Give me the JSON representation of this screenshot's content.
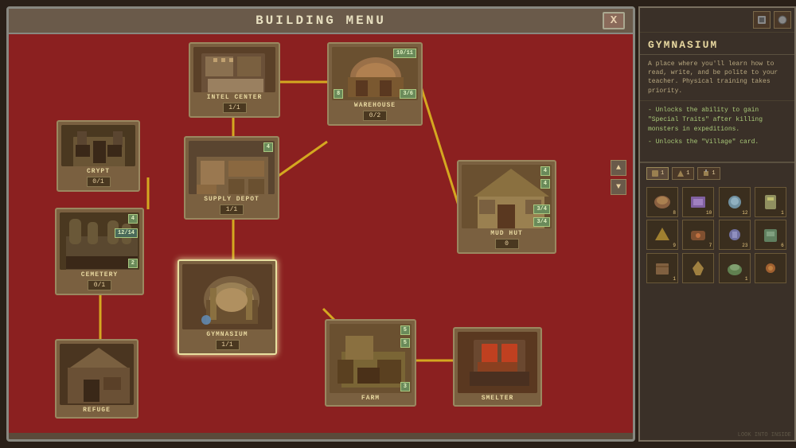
{
  "menu": {
    "title": "BUILDING MENU",
    "close_label": "X"
  },
  "buildings": [
    {
      "id": "intel-center",
      "label": "INTEL CENTER",
      "counter": "1/1",
      "badge_top": null,
      "badge_bottom": null,
      "color": "#6a5030"
    },
    {
      "id": "warehouse",
      "label": "WAREHOUSE",
      "counter": "0/2",
      "badge_top": "10/11",
      "badge_bottom": "8",
      "badge_br": "3/6",
      "color": "#7a6040"
    },
    {
      "id": "crypt",
      "label": "CRYPT",
      "counter": "0/1",
      "color": "#5a4830"
    },
    {
      "id": "supply-depot",
      "label": "SUPPLY DEPOT",
      "counter": "1/1",
      "badge_top": "4",
      "color": "#6a5535"
    },
    {
      "id": "cemetery",
      "label": "CEMETERY",
      "counter": "0/1",
      "badge_top": "4",
      "badge_mid": "12/14",
      "badge_bottom": "2",
      "color": "#5a4528"
    },
    {
      "id": "mud-hut",
      "label": "MUD HUT",
      "counter": "0",
      "badge_top": "4",
      "badge_mid": "4",
      "badge_br": "3/4",
      "badge_br2": "3/4",
      "color": "#7a6040"
    },
    {
      "id": "gymnasium",
      "label": "GYMNASIUM",
      "counter": "1/1",
      "selected": true,
      "color": "#6a5030"
    },
    {
      "id": "farm",
      "label": "FARM",
      "badge_top": "5",
      "badge_mid": "5",
      "badge_bottom": "3",
      "color": "#7a6040"
    },
    {
      "id": "smelter",
      "label": "SMELTER",
      "color": "#6a5030"
    },
    {
      "id": "refuge",
      "label": "REFUGE",
      "color": "#5a4525"
    }
  ],
  "right_panel": {
    "title": "GYMNASIUM",
    "description": "A place where you'll learn how to read, write, and be polite to your teacher. Physical training takes priority.",
    "bullets": [
      "- Unlocks the ability to gain \"Special Traits\" after killing monsters in expeditions.",
      "- Unlocks the \"Village\" card."
    ]
  },
  "resource_tabs": [
    {
      "icon": "🏛",
      "count": "1"
    },
    {
      "icon": "⚒",
      "count": "1"
    },
    {
      "icon": "🔧",
      "count": "1"
    }
  ],
  "resources": [
    {
      "count": "8"
    },
    {
      "count": "10"
    },
    {
      "count": "12"
    },
    {
      "count": "1"
    },
    {
      "count": "9"
    },
    {
      "count": "7"
    },
    {
      "count": "23"
    },
    {
      "count": "6"
    },
    {
      "count": "1"
    },
    {
      "count": ""
    },
    {
      "count": "1"
    },
    {
      "count": ""
    }
  ],
  "scroll": {
    "up": "▲",
    "down": "▼"
  }
}
